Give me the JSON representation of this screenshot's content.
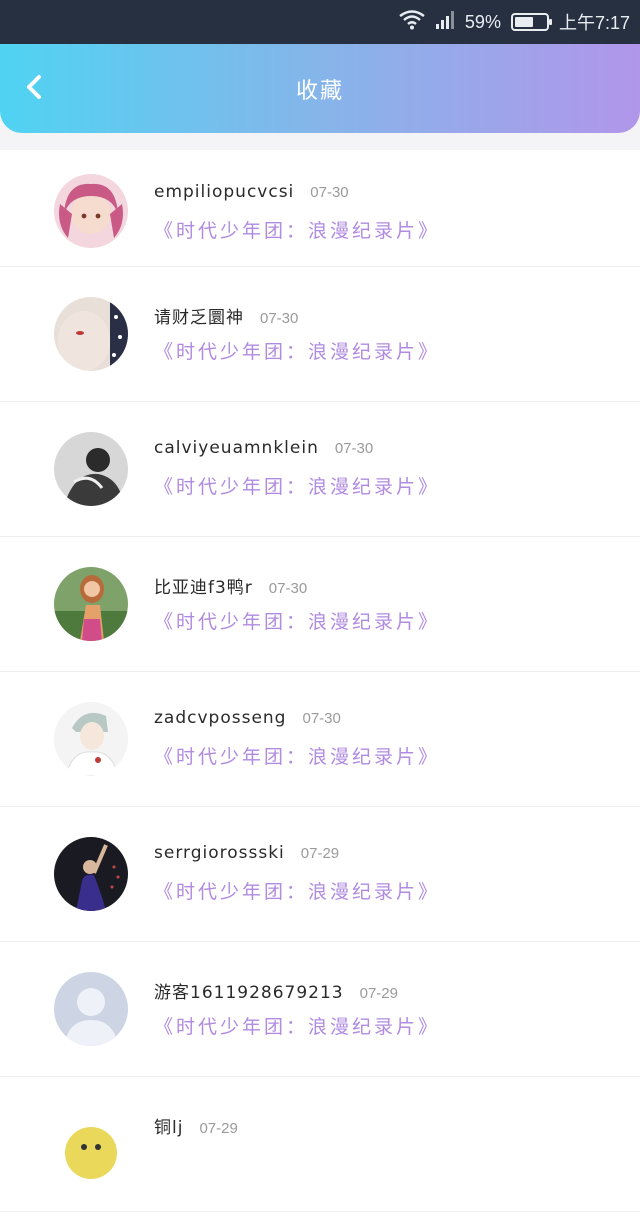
{
  "status_bar": {
    "battery_percent": "59%",
    "battery_level": 0.59,
    "time": "上午7:17",
    "icons": [
      "wifi-icon",
      "signal-icon",
      "battery-icon"
    ]
  },
  "header": {
    "title": "收藏",
    "back_icon": "chevron-left-icon"
  },
  "colors": {
    "header_gradient_start": "#4fd3f2",
    "header_gradient_end": "#b196ea",
    "work_title": "#b08be0"
  },
  "favorites": [
    {
      "username": "empiliopucvcsi",
      "date": "07-30",
      "work": "《时代少年团：浪漫纪录片》"
    },
    {
      "username": "请财乏圜神",
      "date": "07-30",
      "work": "《时代少年团：浪漫纪录片》"
    },
    {
      "username": "calviyeuamnklein",
      "date": "07-30",
      "work": "《时代少年团：浪漫纪录片》"
    },
    {
      "username": "比亚迪f3鸭r",
      "date": "07-30",
      "work": "《时代少年团：浪漫纪录片》"
    },
    {
      "username": "zadcvposseng",
      "date": "07-30",
      "work": "《时代少年团：浪漫纪录片》"
    },
    {
      "username": "serrgiorossski",
      "date": "07-29",
      "work": "《时代少年团：浪漫纪录片》"
    },
    {
      "username": "游客1611928679213",
      "date": "07-29",
      "work": "《时代少年团：浪漫纪录片》"
    },
    {
      "username": "铜lj",
      "date": "07-29",
      "work": ""
    }
  ]
}
